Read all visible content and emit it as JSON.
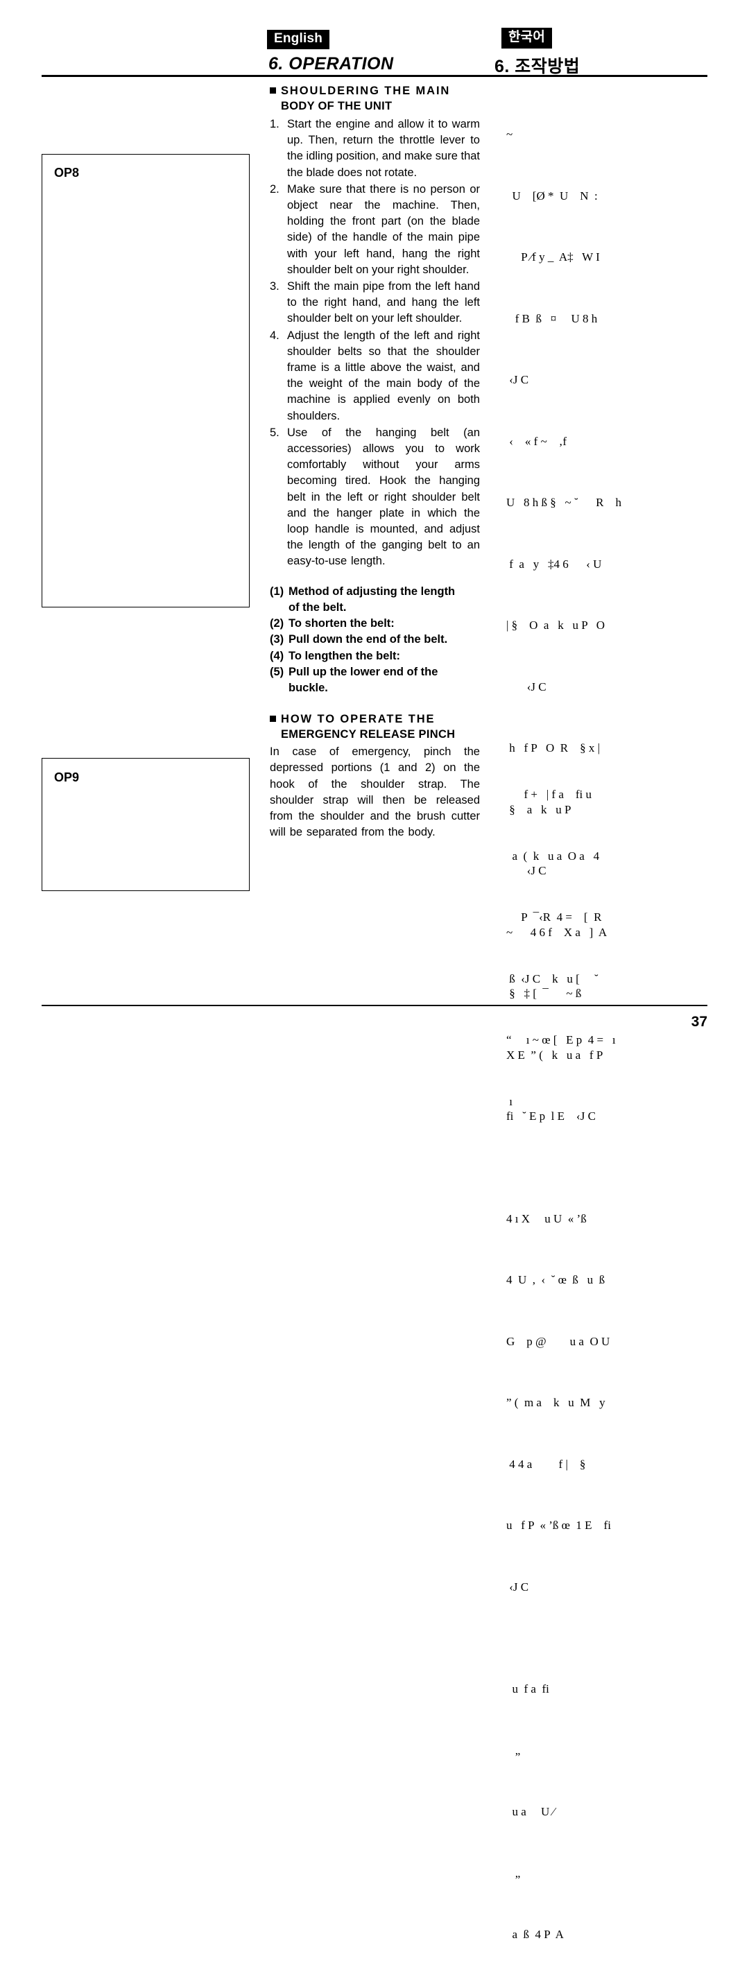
{
  "header": {
    "lang_en": "English",
    "lang_ko": "한국어",
    "title_en": "6. OPERATION",
    "title_ko": "6. 조작방법"
  },
  "figures": [
    {
      "label": "OP8"
    },
    {
      "label": "OP9"
    }
  ],
  "english": {
    "heading1_line1": "SHOULDERING  THE  MAIN",
    "heading1_line2": "BODY OF THE UNIT",
    "steps": [
      {
        "num": "1.",
        "text": "Start the engine and allow it to warm up. Then, return the throttle lever to the idling position, and make sure that the blade does not rotate."
      },
      {
        "num": "2.",
        "text": "Make sure that there is no person or object near the machine. Then, holding the front part (on the blade side) of the handle of the main pipe with your left hand, hang the right shoulder belt on your right shoulder."
      },
      {
        "num": "3.",
        "text": "Shift the main pipe from the left hand to the right hand, and hang the left shoulder belt on your left shoulder."
      },
      {
        "num": "4.",
        "text": "Adjust the length of the left and right shoulder belts so that the shoulder frame is a little above the waist, and the weight of the main body of the machine is applied evenly on both shoulders."
      },
      {
        "num": "5.",
        "text": "Use of the hanging belt (an accessories) allows you to work comfortably without your arms becoming tired. Hook the hanging belt in the left or right shoulder belt and the hanger plate in which the loop handle is mounted, and adjust the length of the ganging belt to an easy-to-use length."
      }
    ],
    "bold_items": [
      {
        "num": "(1)",
        "text": "Method of adjusting the length",
        "cont": "of the belt."
      },
      {
        "num": "(2)",
        "text": "To shorten the belt:",
        "cont": ""
      },
      {
        "num": "(3)",
        "text": "Pull down the end of the belt.",
        "cont": ""
      },
      {
        "num": "(4)",
        "text": "To lengthen the belt:",
        "cont": ""
      },
      {
        "num": "(5)",
        "text": "Pull up the lower end of the",
        "cont": "buckle."
      }
    ],
    "heading2_line1": "HOW  TO  OPERATE  THE",
    "heading2_line2": "EMERGENCY RELEASE PINCH",
    "paragraph2": "In case of emergency, pinch the depressed portions (1 and 2) on the hook of the shoulder strap. The shoulder strap will then be released from the shoulder and the brush cutter will be separated from the body."
  },
  "korean": {
    "block1": [
      "~",
      "  U    [Ø *  U    N  :",
      "     P ⁄f y _  A‡   W I",
      "   f B  ß   ¤     U 8 h",
      " ‹J C",
      " ‹    « f ~    ‚f",
      "U   8 h ß §   ~ ˘      R    h",
      " f  a   y   ‡4 6      ‹ U",
      "| §    O  a   k   u P   O",
      "       ‹J C",
      " h   f P   O  R    § x |",
      " §    a   k   u P",
      "       ‹J C",
      "~      4 6 f    X a   ]  A",
      " §   ‡ [  ¯      ~ ß",
      "X E  ” (   k   u a   f P",
      "fi   ˘ E p  l E    ‹J C",
      "",
      "4 ı X     u U  « ’ß",
      "4  U  ,  ‹  ˘ œ  ß   u  ß",
      "G    p @        u a  O U",
      "” (  m a    k   u  M   y",
      " 4 4 a         f |    §",
      "u   f P  « ’ß œ  1 E    fi",
      " ‹J C",
      "",
      "  u  f a  fi",
      "   „",
      "  u a     U ⁄",
      "   „",
      "  a  ß  4 P  A"
    ],
    "block2": [
      "      f +   | f a    fi u",
      "  a  (  k   u a  O a   4",
      "     P  ¯‹R  4 =    [  R",
      " ß  ‹J C    k   u [     ˘",
      "“     ı ~ œ [   E p  4 =   ı",
      " ı"
    ]
  },
  "page_number": "37"
}
